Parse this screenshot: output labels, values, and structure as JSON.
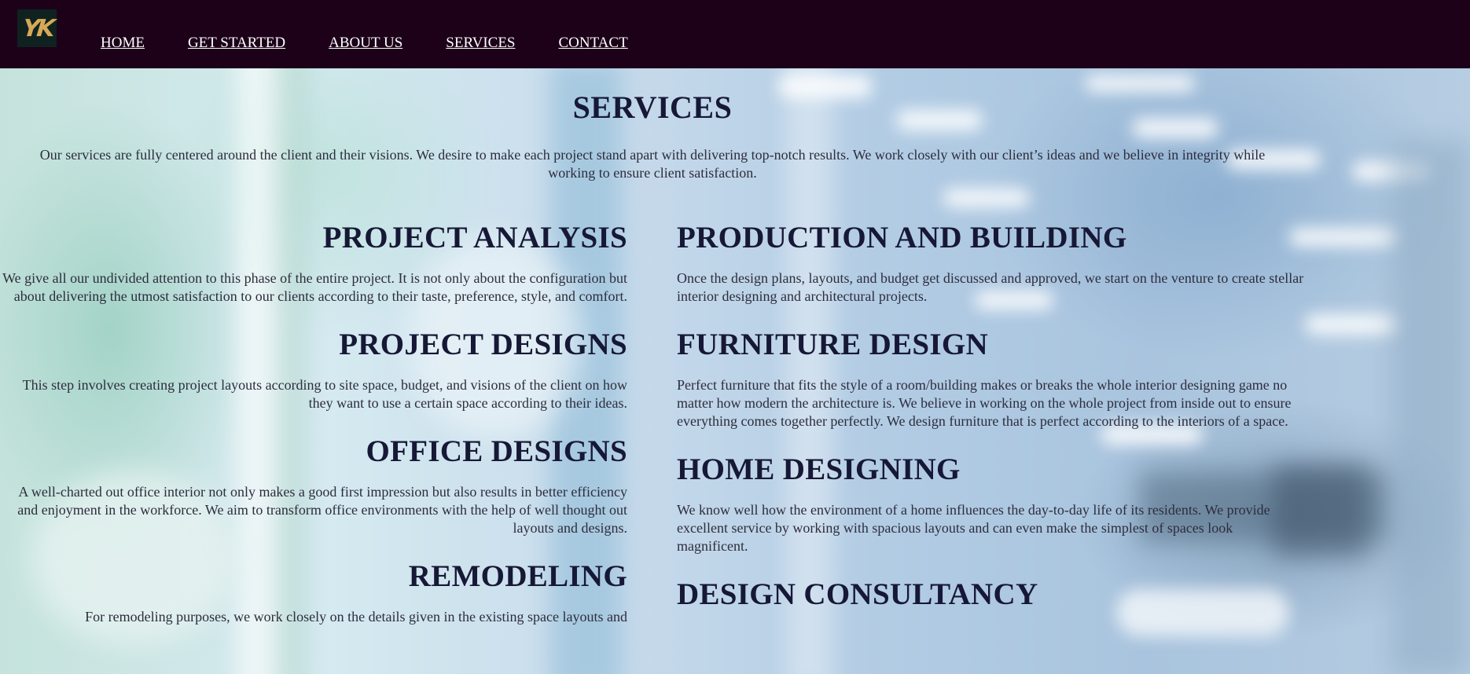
{
  "nav": {
    "logo_text": "YK",
    "items": [
      "HOME",
      "GET STARTED",
      "ABOUT US",
      "SERVICES",
      "CONTACT"
    ]
  },
  "page": {
    "title": "SERVICES",
    "intro": "Our services are fully centered around the client and their visions. We desire to make each project stand apart with delivering top-notch results. We work closely with our client’s ideas and we believe in integrity while working to ensure client satisfaction."
  },
  "left_services": [
    {
      "title": "PROJECT ANALYSIS",
      "text": "We give all our undivided attention to this phase of the entire project. It is not only about the configuration but about delivering the utmost satisfaction to our clients according to their taste, preference, style, and comfort."
    },
    {
      "title": "PROJECT DESIGNS",
      "text": "This step involves creating project layouts according to site space, budget, and visions of the client on how they want to use a certain space according to their ideas."
    },
    {
      "title": "OFFICE DESIGNS",
      "text": "A well-charted out office interior not only makes a good first impression but also results in better efficiency and enjoyment in the workforce. We aim to transform office environments with the help of well thought out layouts and designs."
    },
    {
      "title": "REMODELING",
      "text": "For remodeling purposes, we work closely on the details given in the existing space layouts and"
    }
  ],
  "right_services": [
    {
      "title": "PRODUCTION AND BUILDING",
      "text": "Once the design plans, layouts, and budget get discussed and approved, we start on the venture to create stellar interior designing and architectural projects."
    },
    {
      "title": "FURNITURE DESIGN",
      "text": "Perfect furniture that fits the style of a room/building makes or breaks the whole interior designing game no matter how modern the architecture is. We believe in working on the whole project from inside out to ensure everything comes together perfectly. We design furniture that is perfect according to the interiors of a space."
    },
    {
      "title": "HOME DESIGNING",
      "text": "We know well how the environment of a home influences the day-to-day life of its residents. We provide excellent service by working with spacious layouts and can even make the simplest of spaces look magnificent."
    },
    {
      "title": "DESIGN CONSULTANCY",
      "text": ""
    }
  ],
  "colors": {
    "navbar_bg": "#1c0119",
    "heading": "#161836",
    "body_text": "#2d2d3c",
    "logo_gold": "#d7a956"
  }
}
